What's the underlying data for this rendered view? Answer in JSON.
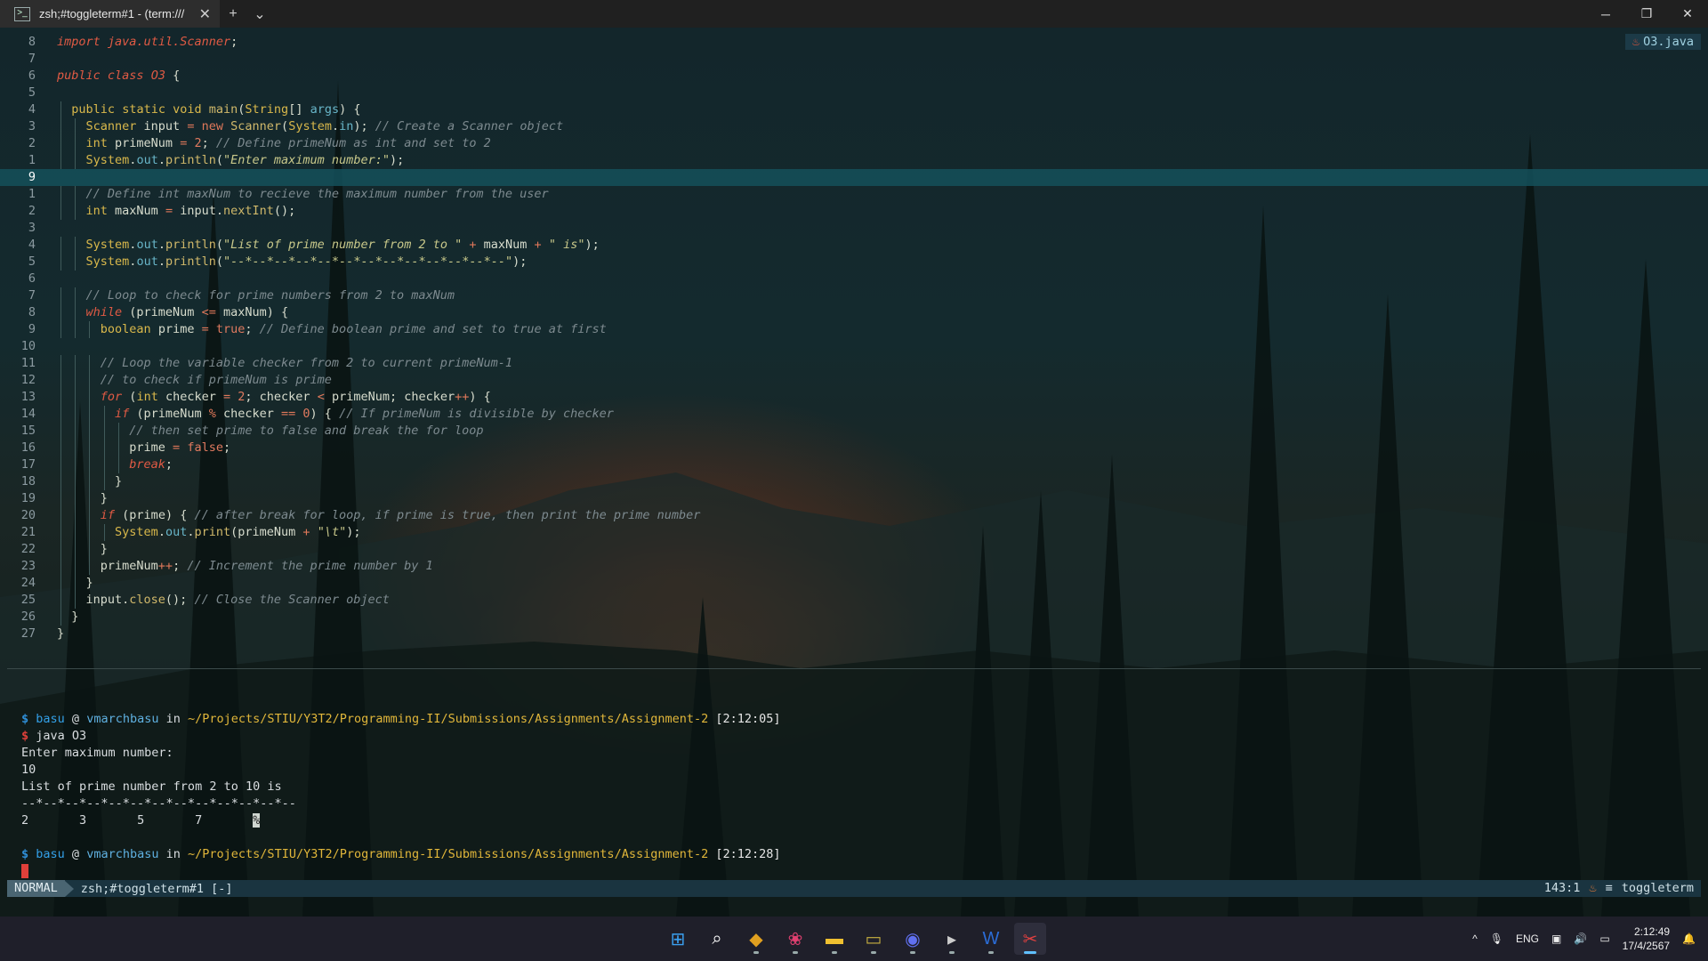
{
  "window": {
    "tab_title": "zsh;#toggleterm#1 - (term:///",
    "tab_icon": "terminal-icon",
    "new_tab": "+",
    "dropdown": "⌄",
    "close_tab": "✕",
    "minimize": "─",
    "restore": "❐",
    "close": "✕"
  },
  "editor": {
    "file_badge": "O3.java",
    "lines": [
      {
        "n": "8",
        "html": "<span class=\"kw\">import</span> <span class=\"kw\">java.util.Scanner</span>;"
      },
      {
        "n": "7",
        "html": ""
      },
      {
        "n": "6",
        "html": "<span class=\"kw\">public</span> <span class=\"kw\">class</span> <span class=\"kw\">O3</span> {"
      },
      {
        "n": "5",
        "html": ""
      },
      {
        "n": "4",
        "html": "  <span class=\"ty\">public</span> <span class=\"ty\">static</span> <span class=\"ty\">void</span> <span class=\"fn\">main</span>(<span class=\"ty\">String</span>[] <span class=\"mem\">args</span>) {"
      },
      {
        "n": "3",
        "html": "    <span class=\"ty\">Scanner</span> input <span class=\"op\">=</span> <span class=\"op\">new</span> <span class=\"fn\">Scanner</span>(<span class=\"ty\">System</span>.<span class=\"mem\">in</span>); <span class=\"cmt\">// Create a Scanner object</span>"
      },
      {
        "n": "2",
        "html": "    <span class=\"ty\">int</span> primeNum <span class=\"op\">=</span> <span class=\"num\">2</span>; <span class=\"cmt\">// Define primeNum as int and set to 2</span>"
      },
      {
        "n": "1",
        "html": "    <span class=\"ty\">System</span>.<span class=\"mem\">out</span>.<span class=\"fn\">println</span>(<span class=\"str\">\"Enter maximum number:\"</span>);"
      },
      {
        "n": "9",
        "html": "",
        "cur": true
      },
      {
        "n": "1",
        "html": "    <span class=\"cmt\">// Define int maxNum to recieve the maximum number from the user</span>"
      },
      {
        "n": "2",
        "html": "    <span class=\"ty\">int</span> maxNum <span class=\"op\">=</span> input.<span class=\"fn\">nextInt</span>();"
      },
      {
        "n": "3",
        "html": ""
      },
      {
        "n": "4",
        "html": "    <span class=\"ty\">System</span>.<span class=\"mem\">out</span>.<span class=\"fn\">println</span>(<span class=\"str\">\"List of prime number from 2 to \"</span> <span class=\"op\">+</span> maxNum <span class=\"op\">+</span> <span class=\"str\">\" is\"</span>);"
      },
      {
        "n": "5",
        "html": "    <span class=\"ty\">System</span>.<span class=\"mem\">out</span>.<span class=\"fn\">println</span>(<span class=\"str\">\"--*--*--*--*--*--*--*--*--*--*--*--*--\"</span>);"
      },
      {
        "n": "6",
        "html": ""
      },
      {
        "n": "7",
        "html": "    <span class=\"cmt\">// Loop to check for prime numbers from 2 to maxNum</span>"
      },
      {
        "n": "8",
        "html": "    <span class=\"kw\">while</span> (primeNum <span class=\"op\">&lt;=</span> maxNum) {"
      },
      {
        "n": "9",
        "html": "      <span class=\"ty\">boolean</span> prime <span class=\"op\">=</span> <span class=\"num\">true</span>; <span class=\"cmt\">// Define boolean prime and set to true at first</span>"
      },
      {
        "n": "10",
        "html": ""
      },
      {
        "n": "11",
        "html": "      <span class=\"cmt\">// Loop the variable checker from 2 to current primeNum-1</span>"
      },
      {
        "n": "12",
        "html": "      <span class=\"cmt\">// to check if primeNum is prime</span>"
      },
      {
        "n": "13",
        "html": "      <span class=\"kw\">for</span> (<span class=\"ty\">int</span> checker <span class=\"op\">=</span> <span class=\"num\">2</span>; checker <span class=\"op\">&lt;</span> primeNum; checker<span class=\"op\">++</span>) {"
      },
      {
        "n": "14",
        "html": "        <span class=\"kw\">if</span> (primeNum <span class=\"op\">%</span> checker <span class=\"op\">==</span> <span class=\"num\">0</span>) { <span class=\"cmt\">// If primeNum is divisible by checker</span>"
      },
      {
        "n": "15",
        "html": "          <span class=\"cmt\">// then set prime to false and break the for loop</span>"
      },
      {
        "n": "16",
        "html": "          prime <span class=\"op\">=</span> <span class=\"num\">false</span>;"
      },
      {
        "n": "17",
        "html": "          <span class=\"kw\">break</span>;"
      },
      {
        "n": "18",
        "html": "        }"
      },
      {
        "n": "19",
        "html": "      }"
      },
      {
        "n": "20",
        "html": "      <span class=\"kw\">if</span> (prime) { <span class=\"cmt\">// after break for loop, if prime is true, then print the prime number</span>"
      },
      {
        "n": "21",
        "html": "        <span class=\"ty\">System</span>.<span class=\"mem\">out</span>.<span class=\"fn\">print</span>(primeNum <span class=\"op\">+</span> <span class=\"str\">\"\\t\"</span>);"
      },
      {
        "n": "22",
        "html": "      }"
      },
      {
        "n": "23",
        "html": "      primeNum<span class=\"op\">++</span>; <span class=\"cmt\">// Increment the prime number by 1</span>"
      },
      {
        "n": "24",
        "html": "    }"
      },
      {
        "n": "25",
        "html": "    input.<span class=\"fn\">close</span>(); <span class=\"cmt\">// Close the Scanner object</span>"
      },
      {
        "n": "26",
        "html": "  }"
      },
      {
        "n": "27",
        "html": "}"
      }
    ]
  },
  "terminal": {
    "user": "basu",
    "at": "@",
    "host": "vmarchbasu",
    "in": "in",
    "path": "~/Projects/STIU/Y3T2/Programming-II/Submissions/Assignments/Assignment-2",
    "time1": "[2:12:05]",
    "command": "java O3",
    "out1": "Enter maximum number:",
    "input": "10",
    "out2": "List of prime number from 2 to 10 is",
    "separator": "--*--*--*--*--*--*--*--*--*--*--*--*--",
    "primes": [
      "2",
      "3",
      "5",
      "7"
    ],
    "time2": "[2:12:28]"
  },
  "statusline": {
    "mode": "NORMAL",
    "buffer": "zsh;#toggleterm#1 [-]",
    "position": "143:1",
    "filetype": "toggleterm"
  },
  "taskbar": {
    "apps": [
      {
        "name": "start-icon",
        "glyph": "⊞",
        "color": "#3aa0f0"
      },
      {
        "name": "search-icon",
        "glyph": "⌕",
        "color": "#ffffff"
      },
      {
        "name": "copilot-icon",
        "glyph": "◆",
        "color": "#e0a020"
      },
      {
        "name": "photos-icon",
        "glyph": "❀",
        "color": "#e04070"
      },
      {
        "name": "file-explorer-icon",
        "glyph": "▬",
        "color": "#f0c030"
      },
      {
        "name": "gamebar-icon",
        "glyph": "▭",
        "color": "#c8b040"
      },
      {
        "name": "discord-icon",
        "glyph": "◉",
        "color": "#6070f0"
      },
      {
        "name": "terminal-icon",
        "glyph": "▸",
        "color": "#cccccc"
      },
      {
        "name": "word-icon",
        "glyph": "W",
        "color": "#2b6cd6"
      },
      {
        "name": "snipping-tool-icon",
        "glyph": "✂",
        "color": "#e04040"
      }
    ],
    "tray": {
      "chevron": "^",
      "lang": "ENG",
      "time": "2:12:49",
      "date": "17/4/2567"
    }
  }
}
